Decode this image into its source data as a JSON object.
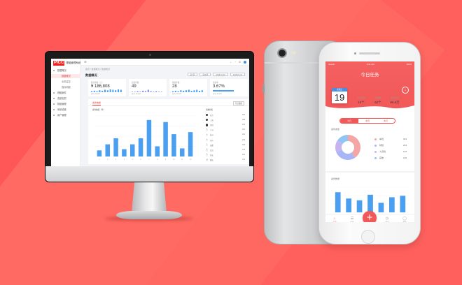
{
  "colors": {
    "background": "#ff5757",
    "accent": "#f25858",
    "bar": "#4a9ff0",
    "pie": [
      "#f4a6a6",
      "#a9b6f5",
      "#c8b3f2",
      "#8fc5f5"
    ]
  },
  "desktop": {
    "logo_mark": "PICC",
    "logo_text": "理赔管理系统",
    "sidebar": [
      {
        "label": "数据概况",
        "type": "group"
      },
      {
        "label": "数据概况",
        "type": "sub",
        "active": true
      },
      {
        "label": "业务监控",
        "type": "sub"
      },
      {
        "label": "指标明细",
        "type": "sub"
      },
      {
        "label": "理赔案件",
        "type": "group"
      },
      {
        "label": "查勘定损",
        "type": "group"
      },
      {
        "label": "核赔管理",
        "type": "group"
      },
      {
        "label": "系统设置",
        "type": "group"
      },
      {
        "label": "用户管理",
        "type": "group"
      }
    ],
    "breadcrumb": "首页 / 数据概况 / 数据概况",
    "page_title": "数据概况",
    "filters": [
      "近7天",
      "近30天",
      "2018-01-01",
      "2018-01-31"
    ],
    "kpis": [
      {
        "label": "赔款金额（元）",
        "value": "¥ 186,808",
        "foot": "日均 12,423"
      },
      {
        "label": "结案件数",
        "value": "49",
        "foot": "日均 12,423"
      },
      {
        "label": "报案件数",
        "value": "28",
        "foot": "日均 12,423"
      },
      {
        "label": "结案率",
        "value": "3.67%",
        "foot": "日均 12,423"
      }
    ],
    "panel_tab": "案件数量",
    "panel_button": "导出数据",
    "chart_title": "案件数量（件）",
    "rank_title": "机构排名",
    "rank": [
      {
        "rank": "1",
        "name": "北京",
        "value": "323"
      },
      {
        "rank": "2",
        "name": "上海",
        "value": "298"
      },
      {
        "rank": "3",
        "name": "深圳",
        "value": "276"
      },
      {
        "rank": "4",
        "name": "广州",
        "value": "254"
      },
      {
        "rank": "5",
        "name": "杭州",
        "value": "231"
      },
      {
        "rank": "6",
        "name": "南京",
        "value": "219"
      },
      {
        "rank": "7",
        "name": "成都",
        "value": "198"
      },
      {
        "rank": "8",
        "name": "武汉",
        "value": "176"
      },
      {
        "rank": "9",
        "name": "西安",
        "value": "154"
      },
      {
        "rank": "10",
        "name": "重庆",
        "value": "132"
      }
    ]
  },
  "mobile": {
    "status_left": "Sketch",
    "status_time": "9:41 AM",
    "status_right": "100%",
    "title": "今日任务",
    "cal_month": "星期五",
    "cal_day": "19",
    "stats": [
      {
        "label": "今日任务",
        "value": "10个"
      },
      {
        "label": "已完成",
        "value": "62个"
      },
      {
        "label": "金额合计",
        "value": "¥6.6万"
      }
    ],
    "segments": [
      {
        "label": "今日",
        "on": true
      },
      {
        "label": "本周",
        "on": false
      },
      {
        "label": "本月",
        "on": false
      }
    ],
    "pie_label": "案件类型",
    "bar_label": "案件数量",
    "legend": [
      {
        "name": "车险",
        "value": "324"
      },
      {
        "name": "财险",
        "value": "234"
      },
      {
        "name": "人身险",
        "value": "123"
      },
      {
        "name": "其他",
        "value": "126"
      }
    ],
    "tabs": [
      {
        "label": "首页",
        "icon": "⌂",
        "on": true
      },
      {
        "label": "任务",
        "icon": "☰"
      },
      {
        "label": "",
        "icon": ""
      },
      {
        "label": "消息",
        "icon": "◷"
      },
      {
        "label": "我的",
        "icon": "◯"
      }
    ]
  },
  "chart_data": [
    {
      "type": "bar",
      "title": "案件数量（件）",
      "categories": [
        "1",
        "2",
        "3",
        "4",
        "5",
        "6",
        "7",
        "8",
        "9",
        "10",
        "11",
        "12"
      ],
      "values": [
        15,
        30,
        45,
        18,
        30,
        45,
        90,
        25,
        85,
        55,
        20,
        60
      ],
      "ylim": [
        0,
        100
      ]
    },
    {
      "type": "pie",
      "title": "案件类型",
      "categories": [
        "车险",
        "财险",
        "人身险",
        "其他"
      ],
      "values": [
        324,
        234,
        123,
        126
      ]
    },
    {
      "type": "bar",
      "title": "案件数量",
      "categories": [
        "1",
        "2",
        "3",
        "4",
        "5",
        "6",
        "7"
      ],
      "values": [
        80,
        55,
        48,
        70,
        38,
        60,
        66
      ],
      "ylim": [
        0,
        100
      ]
    }
  ]
}
